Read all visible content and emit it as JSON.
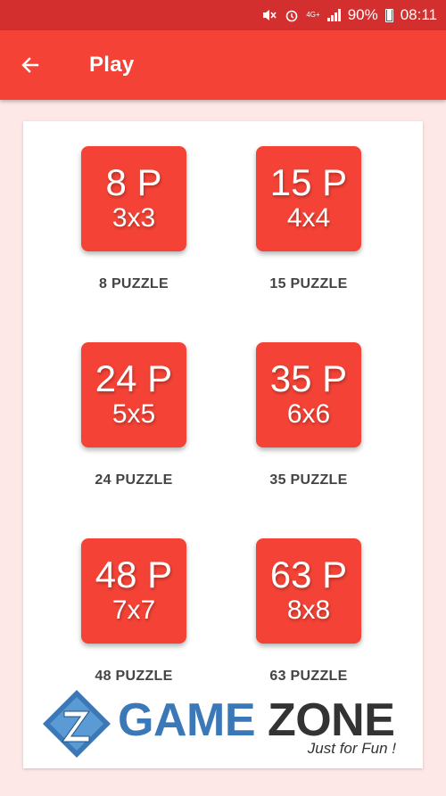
{
  "status_bar": {
    "battery": "90%",
    "time": "08:11",
    "network": "4G+"
  },
  "app_bar": {
    "title": "Play"
  },
  "puzzles": [
    {
      "big": "8 P",
      "size": "3x3",
      "label": "8 PUZZLE"
    },
    {
      "big": "15 P",
      "size": "4x4",
      "label": "15 PUZZLE"
    },
    {
      "big": "24 P",
      "size": "5x5",
      "label": "24 PUZZLE"
    },
    {
      "big": "35 P",
      "size": "6x6",
      "label": "35 PUZZLE"
    },
    {
      "big": "48 P",
      "size": "7x7",
      "label": "48 PUZZLE"
    },
    {
      "big": "63 P",
      "size": "8x8",
      "label": "63 PUZZLE"
    }
  ],
  "watermark": {
    "word1": "GAME",
    "word2": "ZONE",
    "tagline": "Just for Fun !"
  },
  "colors": {
    "status_bar": "#d32f2f",
    "app_bar": "#f44336",
    "tile": "#f44336",
    "background": "#fde7e7"
  }
}
